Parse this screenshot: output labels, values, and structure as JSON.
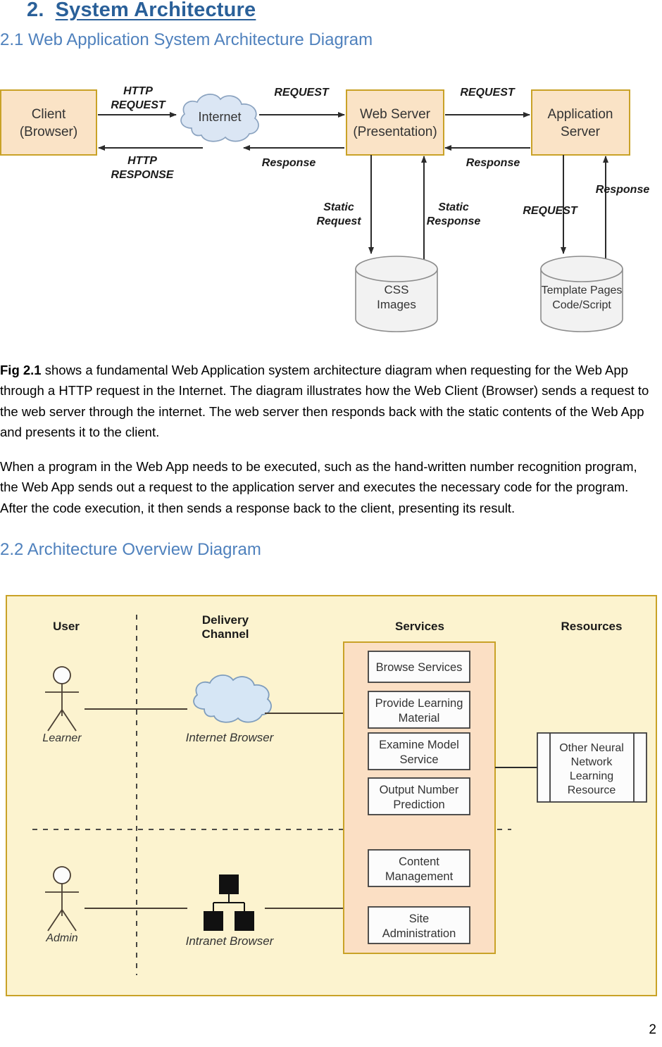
{
  "document": {
    "page_number": "2",
    "heading": {
      "number": "2.",
      "title": "System Architecture"
    },
    "section_2_1": {
      "heading": "2.1 Web Application System Architecture Diagram",
      "paragraph_1_lead": "Fig 2.1",
      "paragraph_1_rest": " shows a fundamental Web Application system architecture diagram when requesting for the Web App through a HTTP request in the Internet. The diagram illustrates how the Web Client (Browser) sends a request to the web server through the internet. The web server then responds back with the static contents of the Web App and presents it to the client.",
      "paragraph_2": "When a program in the Web App needs to be executed, such as the hand-written number recognition program, the Web App sends out a request to the application server and executes the necessary code for the program. After the code execution, it then sends a response back to the client, presenting its result."
    },
    "section_2_2": {
      "heading": "2.2 Architecture Overview Diagram"
    }
  },
  "figure_2_1": {
    "name": "web-application-system-architecture-diagram",
    "nodes": {
      "client": "Client\n(Browser)",
      "client_line1": "Client",
      "client_line2": "(Browser)",
      "internet": "Internet",
      "web_server_line1": "Web Server",
      "web_server_line2": "(Presentation)",
      "app_server_line1": "Application",
      "app_server_line2": "Server",
      "css_store_line1": "CSS",
      "css_store_line2": "Images",
      "template_store_line1": "Template Pages",
      "template_store_line2": "Code/Script"
    },
    "arrows": {
      "http_request_line1": "HTTP",
      "http_request_line2": "REQUEST",
      "http_response_line1": "HTTP",
      "http_response_line2": "RESPONSE",
      "request_internet_to_web": "REQUEST",
      "response_web_to_internet": "Response",
      "request_web_to_app": "REQUEST",
      "response_app_to_web": "Response",
      "static_request_line1": "Static",
      "static_request_line2": "Request",
      "static_response_line1": "Static",
      "static_response_line2": "Response",
      "request_app_to_store": "REQUEST",
      "response_store_to_app": "Response"
    },
    "colors": {
      "box_fill": "#fae3c6",
      "box_stroke": "#c9a227",
      "cloud_fill": "#dbe6f4",
      "cloud_stroke": "#8ba3c0",
      "cylinder_fill": "#f2f2f2",
      "cylinder_stroke": "#8c8c8c",
      "arrow": "#2b2b2b"
    }
  },
  "figure_2_2": {
    "name": "architecture-overview-diagram",
    "column_titles": {
      "user": "User",
      "delivery_channel_line1": "Delivery",
      "delivery_channel_line2": "Channel",
      "services": "Services",
      "resources": "Resources"
    },
    "actors": [
      {
        "label": "Learner"
      },
      {
        "label": "Admin"
      }
    ],
    "channels": [
      {
        "label": "Internet Browser",
        "icon": "cloud-icon"
      },
      {
        "label": "Intranet Browser",
        "icon": "network-tree-icon"
      }
    ],
    "services_learner": [
      "Browse Services",
      "Provide Learning\nMaterial",
      "Examine Model\nService",
      "Output Number\nPrediction"
    ],
    "services_learner_lines": [
      [
        "Browse Services"
      ],
      [
        "Provide Learning",
        "Material"
      ],
      [
        "Examine Model",
        "Service"
      ],
      [
        "Output Number",
        "Prediction"
      ]
    ],
    "services_admin_lines": [
      [
        "Content",
        "Management"
      ],
      [
        "Site",
        "Administration"
      ]
    ],
    "resources": {
      "label_lines": [
        "Other Neural",
        "Network",
        "Learning",
        "Resource"
      ]
    },
    "colors": {
      "canvas_fill": "#fcf3cf",
      "canvas_stroke": "#c9a227",
      "services_fill": "#fbdfc4",
      "services_stroke": "#c9a227",
      "box_fill": "#fcfcfc",
      "box_stroke": "#3d3d3d",
      "cloud_fill": "#d6e6f5",
      "cloud_stroke": "#7f9dbd",
      "line": "#4a3f33"
    }
  }
}
